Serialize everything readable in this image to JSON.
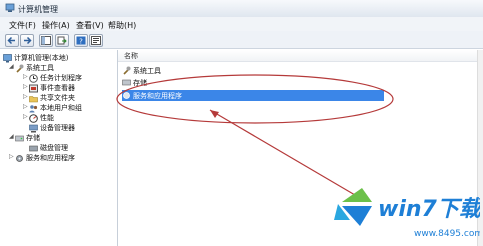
{
  "window": {
    "title": "计算机管理"
  },
  "menu": [
    "文件(F)",
    "操作(A)",
    "查看(V)",
    "帮助(H)"
  ],
  "toolbar": {
    "buttons": [
      "back-icon",
      "forward-icon",
      "show-tree-icon",
      "export-icon",
      "help-icon",
      "properties-icon"
    ]
  },
  "tree": {
    "root": "计算机管理(本地)",
    "system_tools": "系统工具",
    "task_scheduler": "任务计划程序",
    "event_viewer": "事件查看器",
    "shared_folders": "共享文件夹",
    "local_users": "本地用户和组",
    "performance": "性能",
    "device_manager": "设备管理器",
    "storage": "存储",
    "disk_management": "磁盘管理",
    "services_apps": "服务和应用程序"
  },
  "content": {
    "column_header": "名称",
    "items": [
      "系统工具",
      "存储",
      "服务和应用程序"
    ]
  },
  "watermark": {
    "brand": "win7下载吧",
    "url": "www.8495.com"
  },
  "colors": {
    "selection": "#3b86e8",
    "annotation": "#b53a3a",
    "brand_blue": "#1e7fd6"
  }
}
